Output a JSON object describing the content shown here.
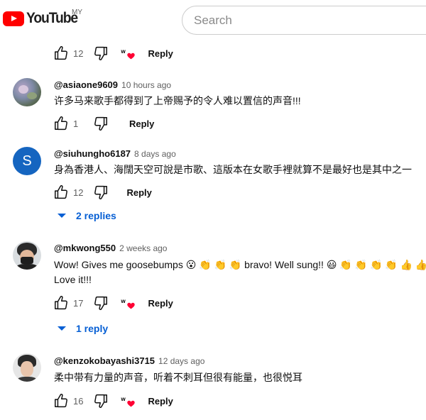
{
  "header": {
    "logo_text": "YouTube",
    "region": "MY",
    "search_placeholder": "Search"
  },
  "top_actions": {
    "likes": "12",
    "reply_label": "Reply"
  },
  "comments": [
    {
      "author": "@asiaone9609",
      "time": "10 hours ago",
      "text": [
        "许多马来歌手都得到了上帝赐予的令人难以置信的声音!!!"
      ],
      "likes": "1",
      "reply_label": "Reply",
      "creator_heart": false
    },
    {
      "author": "@siuhungho6187",
      "time": "8 days ago",
      "avatar_letter": "S",
      "text": [
        "身為香港人、海闊天空可說是市歌、這版本在女歌手裡就算不是最好也是其中之一"
      ],
      "likes": "12",
      "reply_label": "Reply",
      "creator_heart": false,
      "replies_label": "2 replies"
    },
    {
      "author": "@mkwong550",
      "time": "2 weeks ago",
      "text": [
        "Wow! Gives me goosebumps 😮 👏 👏 👏 bravo! Well sung!! 😃 👏 👏 👏 👏 👍 👍",
        "Love it!!!"
      ],
      "likes": "17",
      "reply_label": "Reply",
      "creator_heart": true,
      "replies_label": "1 reply"
    },
    {
      "author": "@kenzokobayashi3715",
      "time": "12 days ago",
      "text": [
        "柔中带有力量的声音，听着不刺耳但很有能量，也很悦耳"
      ],
      "likes": "16",
      "reply_label": "Reply",
      "creator_heart": true
    }
  ],
  "colors": {
    "brand_red": "#ff0000",
    "link_blue": "#065fd4",
    "avatar_blue": "#1565c0",
    "heart_red": "#ff0033"
  }
}
